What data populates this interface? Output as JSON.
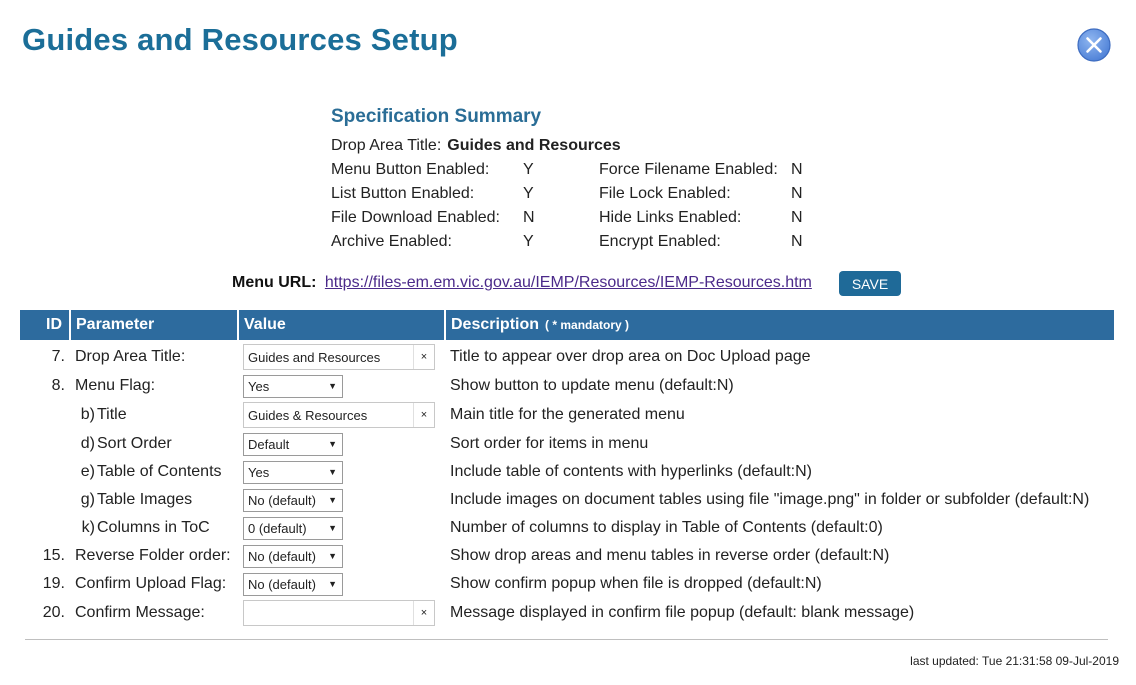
{
  "page": {
    "title": "Guides and Resources Setup",
    "close_icon": "close-circle-icon",
    "accent_color": "#1b6e98"
  },
  "summary": {
    "heading": "Specification Summary",
    "drop_area_label": "Drop Area Title:",
    "drop_area_value": "Guides and Resources",
    "rows": [
      {
        "label_left": "Menu Button Enabled:",
        "value_left": "Y",
        "label_right": "Force Filename Enabled:",
        "value_right": "N"
      },
      {
        "label_left": "List Button Enabled:",
        "value_left": "Y",
        "label_right": "File Lock Enabled:",
        "value_right": "N"
      },
      {
        "label_left": "File Download Enabled:",
        "value_left": "N",
        "label_right": "Hide Links Enabled:",
        "value_right": "N"
      },
      {
        "label_left": "Archive Enabled:",
        "value_left": "Y",
        "label_right": "Encrypt Enabled:",
        "value_right": "N"
      }
    ]
  },
  "menu_url": {
    "label": "Menu URL:",
    "link": "https://files-em.em.vic.gov.au/IEMP/Resources/IEMP-Resources.htm"
  },
  "save_button": {
    "label": "SAVE",
    "color": "#1f6a98"
  },
  "table": {
    "header_color": "#2d6b9e",
    "headers": {
      "id": "ID",
      "parameter": "Parameter",
      "value": "Value",
      "description": "Description",
      "mandatory_note": "( * mandatory )"
    },
    "clear_glyph": "×",
    "rows": [
      {
        "id": "7.",
        "sub": "",
        "parameter": "Drop Area Title:",
        "type": "text",
        "value": "Guides and Resources",
        "description": "Title to appear over drop area on Doc Upload page"
      },
      {
        "id": "8.",
        "sub": "",
        "parameter": "Menu Flag:",
        "type": "select",
        "value": "Yes",
        "description": "Show button to update menu (default:N)"
      },
      {
        "id": "",
        "sub": "b)",
        "parameter": "Title",
        "type": "text",
        "value": "Guides & Resources",
        "description": "Main title for the generated menu"
      },
      {
        "id": "",
        "sub": "d)",
        "parameter": "Sort Order",
        "type": "select",
        "value": "Default",
        "description": "Sort order for items in menu"
      },
      {
        "id": "",
        "sub": "e)",
        "parameter": "Table of Contents",
        "type": "select",
        "value": "Yes",
        "description": "Include table of contents with hyperlinks (default:N)"
      },
      {
        "id": "",
        "sub": "g)",
        "parameter": "Table Images",
        "type": "select",
        "value": "No (default)",
        "description": "Include images on document tables using file \"image.png\" in folder or subfolder (default:N)"
      },
      {
        "id": "",
        "sub": "k)",
        "parameter": "Columns in ToC",
        "type": "select",
        "value": "0 (default)",
        "description": "Number of columns to display in Table of Contents (default:0)"
      },
      {
        "id": "15.",
        "sub": "",
        "parameter": "Reverse Folder order:",
        "type": "select",
        "value": "No (default)",
        "description": "Show drop areas and menu tables in reverse order (default:N)"
      },
      {
        "id": "19.",
        "sub": "",
        "parameter": "Confirm Upload Flag:",
        "type": "select",
        "value": "No (default)",
        "description": "Show confirm popup when file is dropped (default:N)"
      },
      {
        "id": "20.",
        "sub": "",
        "parameter": "Confirm Message:",
        "type": "text",
        "value": "",
        "description": "Message displayed in confirm file popup (default: blank message)"
      }
    ]
  },
  "footer": {
    "last_updated": "last updated: Tue 21:31:58 09-Jul-2019"
  }
}
